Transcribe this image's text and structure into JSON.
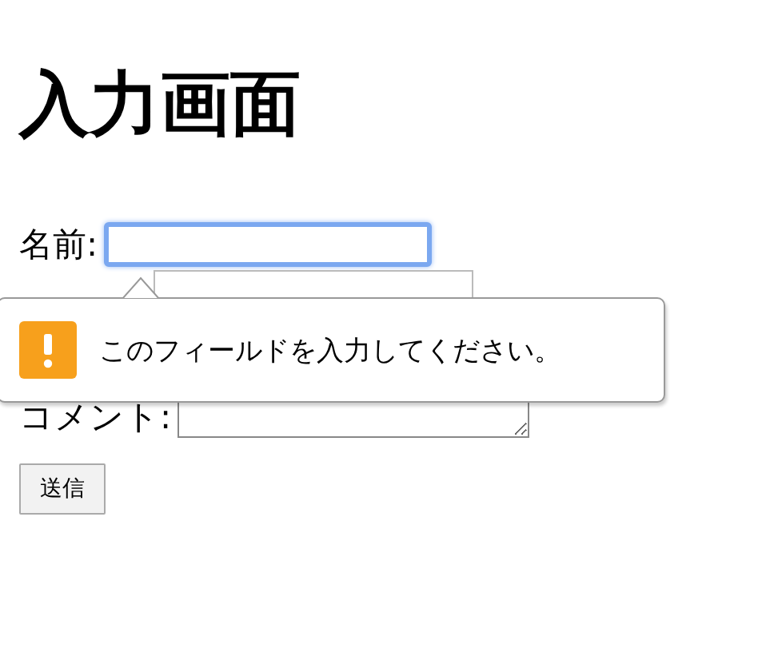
{
  "heading": "入力画面",
  "fields": [
    {
      "kind": "input",
      "label": "名前:",
      "focused": true
    },
    {
      "kind": "input",
      "focused": false
    },
    {
      "kind": "textarea",
      "label": "コメント:",
      "focused": false
    }
  ],
  "tooltip": {
    "message": "このフィールドを入力してください。"
  },
  "submit": "送信"
}
